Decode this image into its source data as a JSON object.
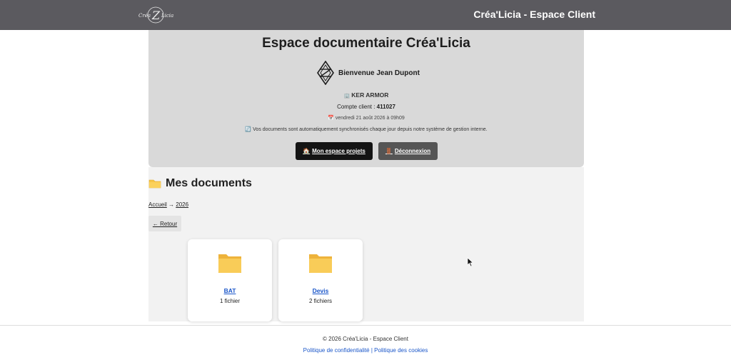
{
  "header": {
    "logo_alt": "Créa'Licia",
    "title": "Créa'Licia - Espace Client"
  },
  "hero": {
    "title": "Espace documentaire Créa'Licia",
    "welcome": "Bienvenue Jean Dupont",
    "company_icon": "🏢",
    "company": "KER ARMOR",
    "account_label": "Compte client : ",
    "account_number": "411027",
    "date_icon": "📅",
    "date": "vendredi 21 août 2026 à 09h09",
    "sync_icon": "🔄",
    "sync_text": "Vos documents sont automatiquement synchronisés chaque jour depuis notre système de gestion interne.",
    "projects_button": "Mon espace projets",
    "projects_icon": "🏠",
    "logout_button": "Déconnexion",
    "logout_icon": "🚪"
  },
  "documents": {
    "title": "Mes documents",
    "breadcrumb": [
      "Accueil",
      "2026"
    ],
    "breadcrumb_separator": " → ",
    "back_label": "← Retour",
    "folders": [
      {
        "name": "BAT",
        "count": "1 fichier"
      },
      {
        "name": "Devis",
        "count": "2 fichiers"
      }
    ]
  },
  "footer": {
    "copyright": "© 2026 Créa'Licia - Espace Client",
    "privacy": "Politique de confidentialité",
    "separator": " | ",
    "cookies": "Politique des cookies"
  },
  "colors": {
    "header_bg": "#5b5a5f",
    "hero_bg": "#d9d9d9",
    "folder_yellow": "#f7c548",
    "link_blue": "#1a56c9"
  }
}
